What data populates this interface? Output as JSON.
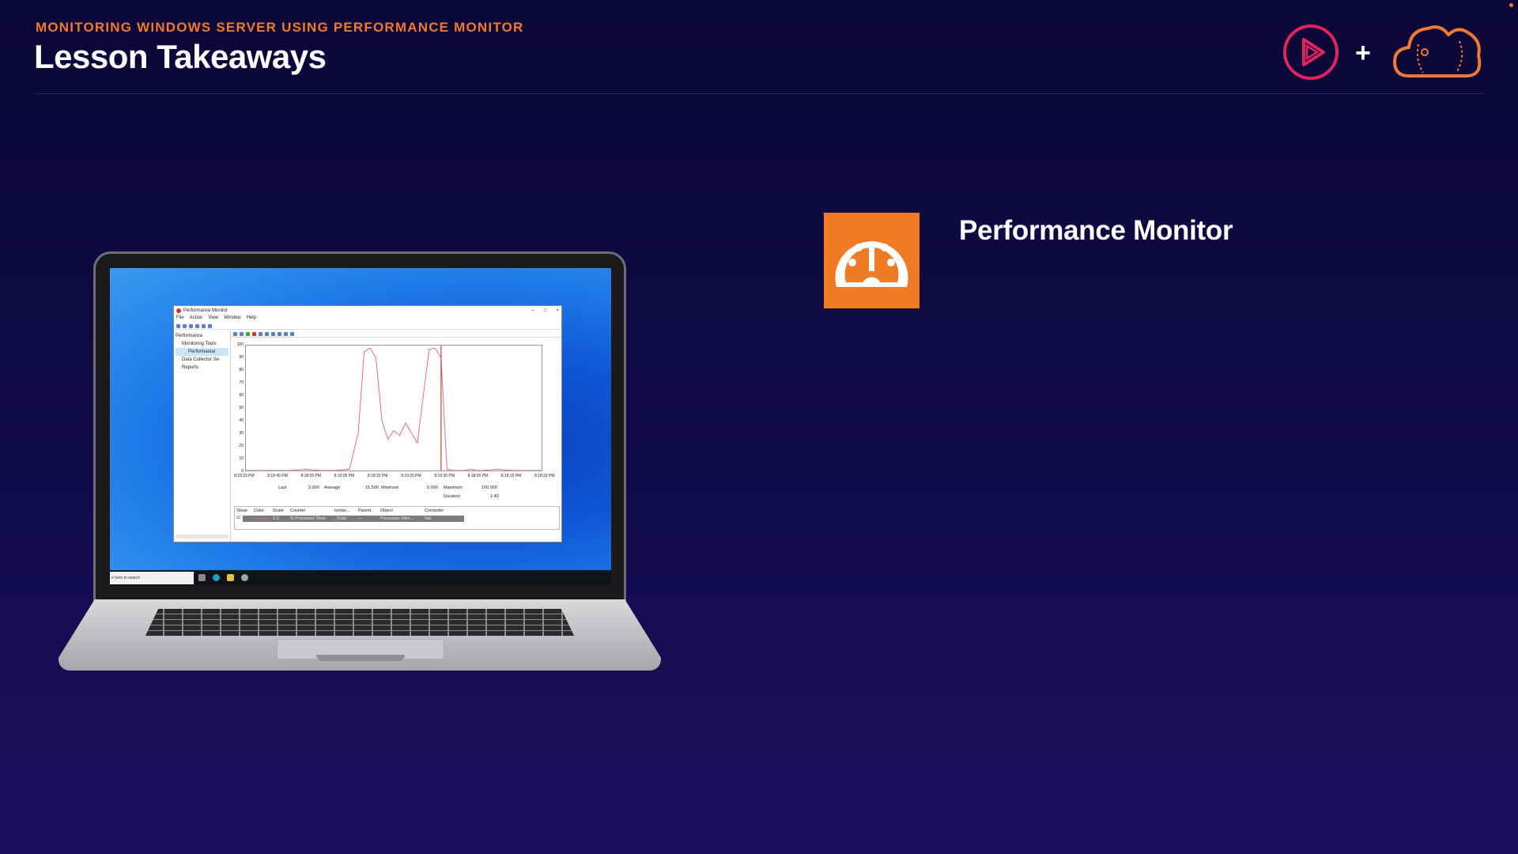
{
  "header": {
    "course_title": "MONITORING WINDOWS SERVER USING PERFORMANCE MONITOR",
    "lesson_title": "Lesson Takeaways",
    "plus_symbol": "+"
  },
  "takeaway": {
    "icon": "gauge-icon",
    "label": "Performance Monitor"
  },
  "colors": {
    "accent": "#f07a32",
    "background": "#120b4a",
    "icon_bg": "#ef7b24",
    "graph_line": "#e07070"
  },
  "perfmon_window": {
    "title": "Performance Monitor",
    "window_controls": [
      "–",
      "□",
      "×"
    ],
    "menu": [
      "File",
      "Action",
      "View",
      "Window",
      "Help"
    ],
    "tree": [
      {
        "label": "Performance",
        "selected": false
      },
      {
        "label": "Monitoring Tools",
        "selected": false
      },
      {
        "label": "Performance",
        "selected": true
      },
      {
        "label": "Data Collector Se",
        "selected": false
      },
      {
        "label": "Reports",
        "selected": false
      }
    ],
    "stats": {
      "last_label": "Last",
      "last_value": "0.000",
      "average_label": "Average",
      "average_value": "15.599",
      "minimum_label": "Minimum",
      "minimum_value": "0.000",
      "maximum_label": "Maximum",
      "maximum_value": "100.000",
      "duration_label": "Duration",
      "duration_value": "1:40"
    },
    "legend": {
      "headers": [
        "Show",
        "Color",
        "Scale",
        "Counter",
        "Instan...",
        "Parent",
        "Object",
        "Computer"
      ],
      "row": {
        "scale": "1.0",
        "counter": "% Processor Time",
        "instance": "_Total",
        "parent": "---",
        "object": "Processor Infor...",
        "computer": "\\\\dc"
      }
    }
  },
  "taskbar": {
    "search_placeholder": "e here to search"
  },
  "chart_data": {
    "type": "line",
    "series": [
      {
        "x": [
          0,
          5,
          10,
          15,
          20,
          25,
          30,
          35,
          38,
          40,
          42,
          44,
          46,
          48,
          50,
          52,
          54,
          56,
          58,
          60,
          62,
          64,
          66,
          68,
          70,
          72,
          74,
          76,
          78,
          80,
          85,
          90,
          95,
          100
        ],
        "values": [
          0,
          0,
          0,
          0,
          1,
          0,
          0,
          1,
          30,
          95,
          98,
          90,
          40,
          25,
          32,
          28,
          38,
          30,
          22,
          60,
          97,
          98,
          90,
          1,
          0,
          0,
          0,
          1,
          0,
          0,
          1,
          0,
          0,
          0
        ]
      }
    ],
    "ylim": [
      0,
      100
    ],
    "yticks": [
      0,
      10,
      20,
      30,
      40,
      50,
      60,
      70,
      80,
      90,
      100
    ],
    "xticks": [
      "8:18:33 PM",
      "8:18:45 PM",
      "8:18:55 PM",
      "8:19:05 PM",
      "8:18:15 PM",
      "8:19:25 PM",
      "8:19:35 PM",
      "8:18:05 PM",
      "8:18:15 PM",
      "8:18:32 PM"
    ],
    "grid": false
  }
}
